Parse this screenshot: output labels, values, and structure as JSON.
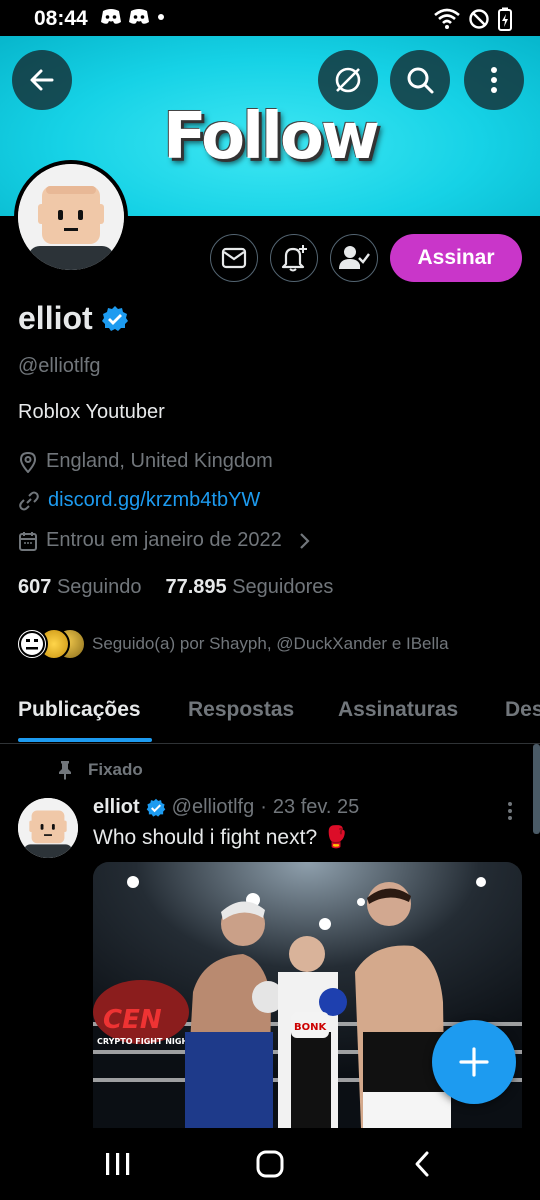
{
  "status_bar": {
    "time": "08:44",
    "icons_left": [
      "discord-icon",
      "discord-icon",
      "dot-icon"
    ],
    "icons_right": [
      "wifi-icon",
      "do-not-disturb-icon",
      "battery-charging-icon"
    ]
  },
  "banner": {
    "text": "Follow",
    "color": "#16d2e6"
  },
  "toolbar": {
    "back_icon": "arrow-left-icon",
    "grok_icon": "slash-circle-icon",
    "search_icon": "search-icon",
    "more_icon": "more-vertical-icon"
  },
  "profile": {
    "name": "elliot",
    "verified": true,
    "handle": "@elliotlfg",
    "bio": "Roblox Youtuber",
    "location": "England, United Kingdom",
    "link": "discord.gg/krzmb4tbYW",
    "joined": "Entrou em janeiro de 2022",
    "following_count": "607",
    "following_label": "Seguindo",
    "followers_count": "77.895",
    "followers_label": "Seguidores",
    "followed_by": "Seguido(a) por Shayph, @DuckXander e IBella"
  },
  "actions": {
    "subscribe_label": "Assinar",
    "accent": "#c936c9"
  },
  "tabs": [
    {
      "label": "Publicações",
      "active": true
    },
    {
      "label": "Respostas",
      "active": false
    },
    {
      "label": "Assinaturas",
      "active": false
    },
    {
      "label": "Des",
      "active": false
    }
  ],
  "pinned_post": {
    "pinned_label": "Fixado",
    "author": "elliot",
    "handle": "@elliotlfg",
    "separator": "·",
    "date": "23 fev. 25",
    "text": "Who should i fight next? 🥊",
    "image_banner_text": "CEN",
    "image_sub_text": "CRYPTO FIGHT NIGHT",
    "image_glove_text": "BONK"
  },
  "fab": {
    "icon": "plus-icon",
    "color": "#1d9bf0"
  },
  "nav": [
    "recent-apps-icon",
    "home-icon",
    "back-icon"
  ]
}
